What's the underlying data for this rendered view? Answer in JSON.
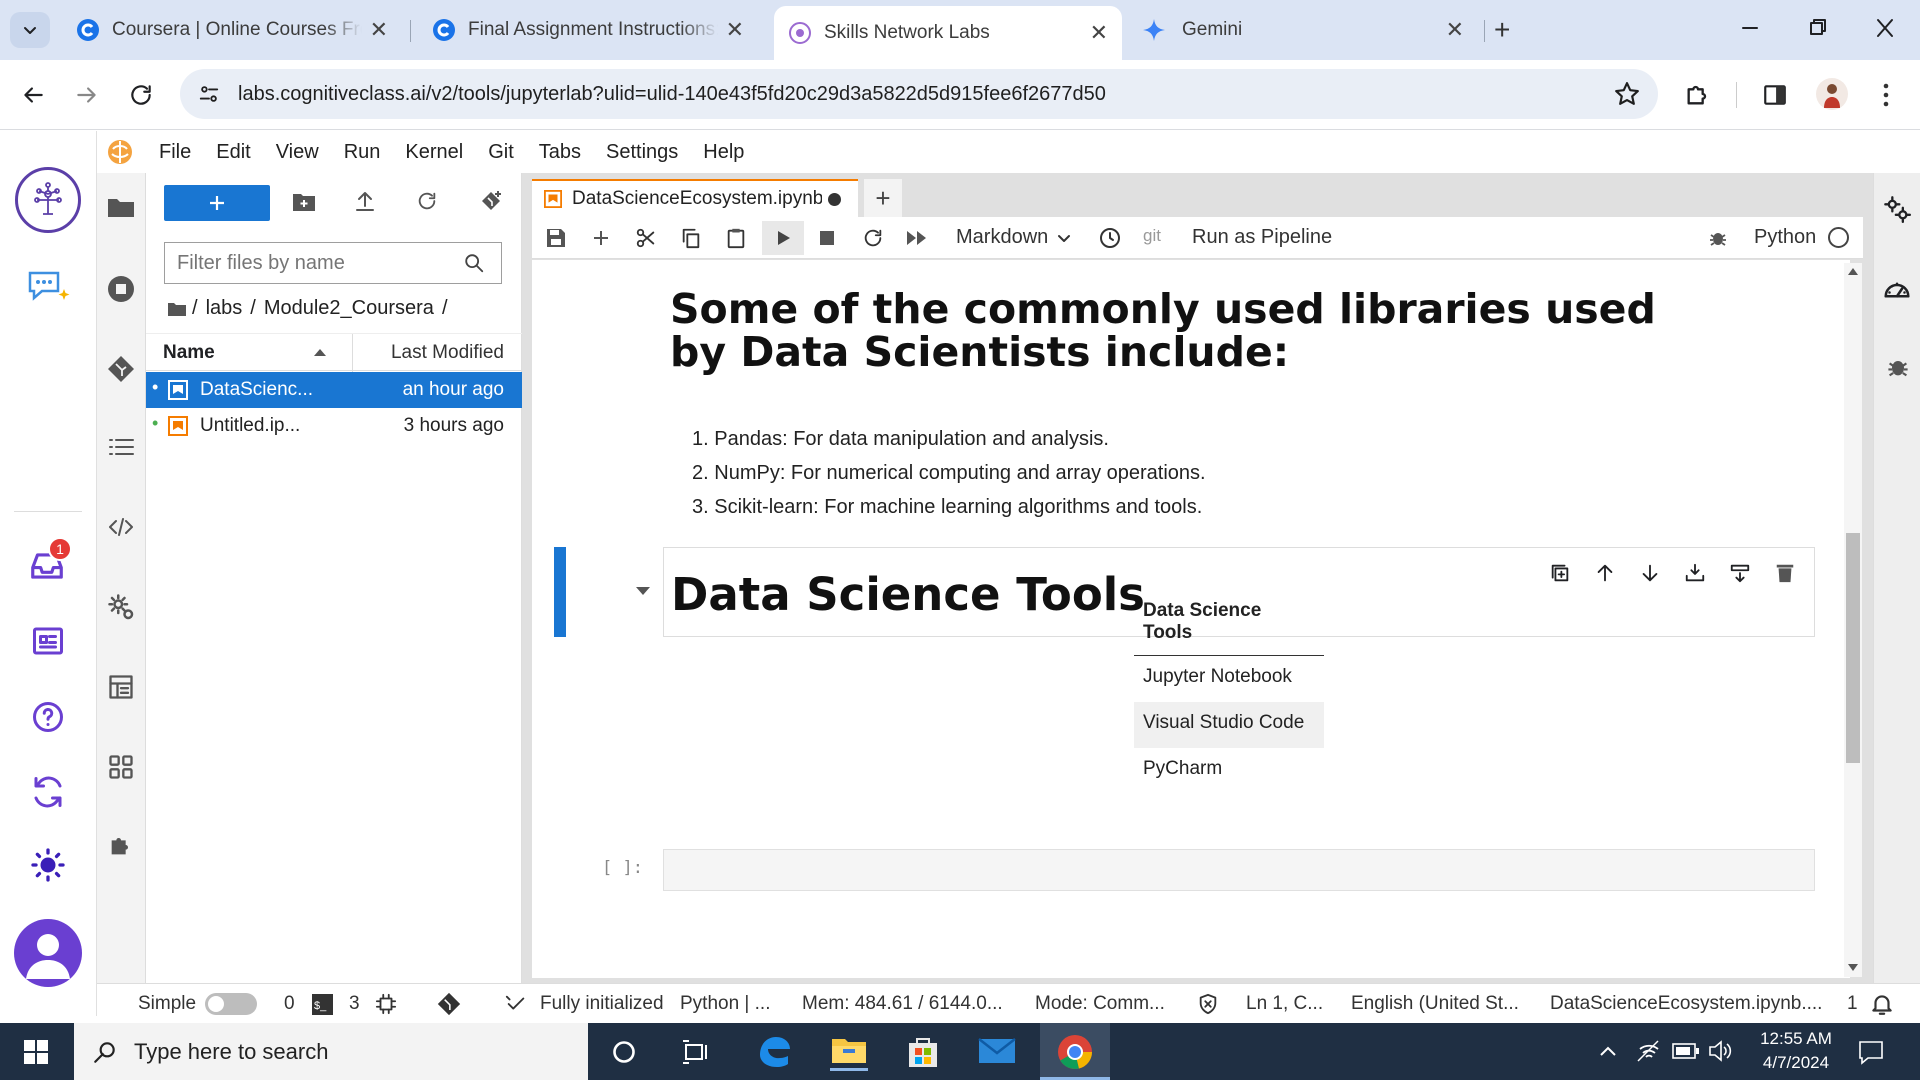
{
  "browser": {
    "tabs": [
      {
        "title": "Coursera | Online Courses From",
        "active": false
      },
      {
        "title": "Final Assignment Instructions: C",
        "active": false
      },
      {
        "title": "Skills Network Labs",
        "active": true
      },
      {
        "title": "Gemini",
        "active": false
      }
    ],
    "url": "labs.cognitiveclass.ai/v2/tools/jupyterlab?ulid=ulid-140e43f5fd20c29d3a5822d5d915fee6f2677d50"
  },
  "menu": [
    "File",
    "Edit",
    "View",
    "Run",
    "Kernel",
    "Git",
    "Tabs",
    "Settings",
    "Help"
  ],
  "sidebar": {
    "notification_count": "1"
  },
  "file_browser": {
    "filter_placeholder": "Filter files by name",
    "breadcrumb": [
      "/",
      "labs",
      "/",
      "Module2_Coursera",
      "/"
    ],
    "col_name": "Name",
    "col_modified": "Last Modified",
    "files": [
      {
        "name": "DataScienc...",
        "modified": "an hour ago",
        "selected": true
      },
      {
        "name": "Untitled.ip...",
        "modified": "3 hours ago",
        "selected": false
      }
    ]
  },
  "notebook": {
    "tab_title": "DataScienceEcosystem.ipynb",
    "cell_type": "Markdown",
    "git_label": "git",
    "pipeline_label": "Run as Pipeline",
    "kernel_name": "Python",
    "heading1": "Some of the commonly used libraries used by Data Scientists include:",
    "libraries": [
      "Pandas: For data manipulation and analysis.",
      "NumPy: For numerical computing and array operations.",
      "Scikit-learn: For machine learning algorithms and tools."
    ],
    "heading2": "Data Science Tools",
    "table": {
      "header": "Data Science Tools",
      "rows": [
        "Jupyter Notebook",
        "Visual Studio Code",
        "PyCharm"
      ]
    },
    "empty_prompt": "[ ]:"
  },
  "status": {
    "mode_label": "Simple",
    "terminals": "0",
    "kernels": "3",
    "init": "Fully initialized",
    "kernel": "Python | ...",
    "mem": "Mem: 484.61 / 6144.0...",
    "mode": "Mode: Comm...",
    "cursor": "Ln 1, C...",
    "lang": "English (United St...",
    "file": "DataScienceEcosystem.ipynb....",
    "notif": "1"
  },
  "taskbar": {
    "search_placeholder": "Type here to search",
    "time": "12:55 AM",
    "date": "4/7/2024"
  },
  "colors": {
    "accent": "#1976d2",
    "selected_row": "#1976d2",
    "taskbar": "#1f2f43"
  }
}
